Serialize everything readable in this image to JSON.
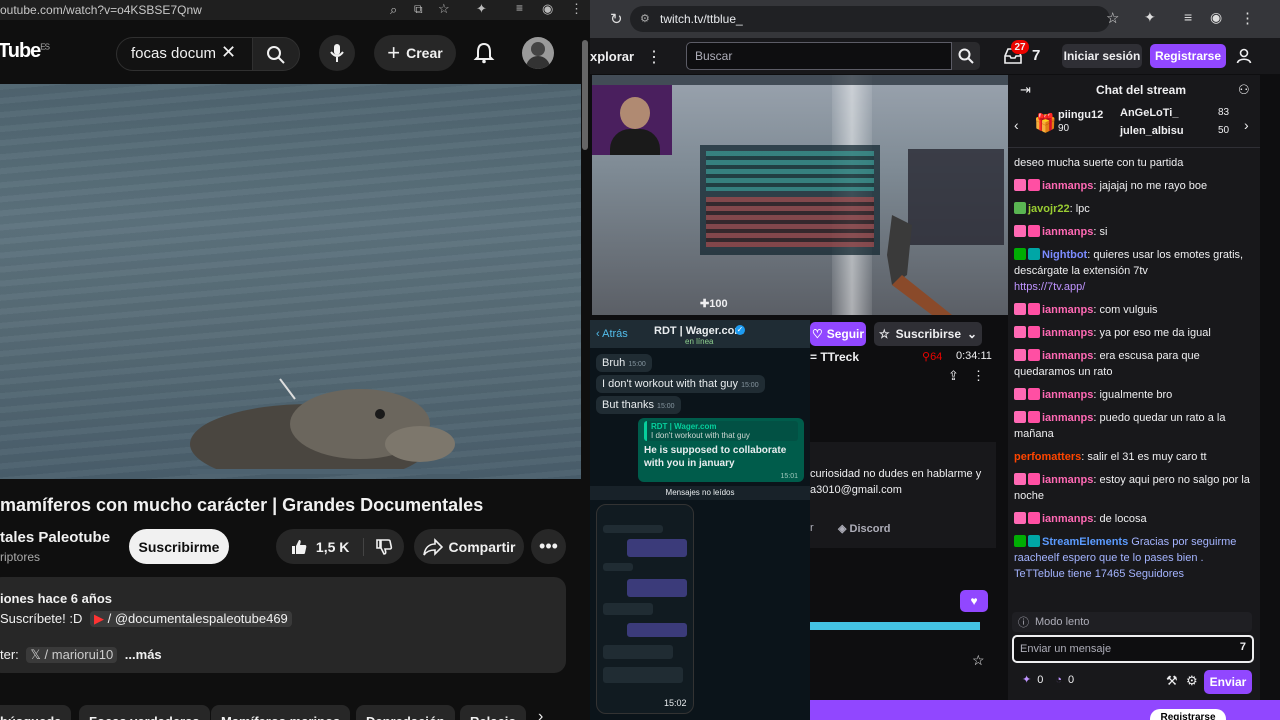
{
  "youtube": {
    "url": "outube.com/watch?v=o4KSBSE7Qnw",
    "logo": "Tube",
    "logo_region": "ES",
    "search_value": "focas docum",
    "create_label": "Crear",
    "video_title": "mamíferos con mucho carácter | Grandes Documentales",
    "channel_name": "tales Paleotube",
    "channel_sub": "riptores",
    "subscribe_label": "Suscribirme",
    "likes": "1,5 K",
    "share_label": "Compartir",
    "desc_meta": "iones  hace 6 años",
    "desc_line2_prefix": "Suscríbete! :D",
    "desc_line2_link": "/ @documentalespaleotube469",
    "desc_line3_prefix": "ter:",
    "desc_line3_link": "/ mariorui10",
    "desc_more": "...más",
    "chips": [
      "búsqueda",
      "Focas verdaderas",
      "Mamíferos marinos",
      "Depredación",
      "Relacio"
    ]
  },
  "twitch": {
    "url": "twitch.tv/ttblue_",
    "explore": "xplorar",
    "search_placeholder": "Buscar",
    "notif_count": "27",
    "login_label": "Iniciar sesión",
    "register_label": "Registrarse",
    "chat_title": "Chat del stream",
    "follow_label": "Seguir",
    "subscribe_label": "Suscribirse",
    "streamer_name": "TTreck",
    "viewers": "64",
    "uptime": "0:34:11",
    "about_text": "curiosidad no dudes en hablarme y",
    "about_email": "a3010@gmail.com",
    "discord_label": "Discord",
    "about_link_prefix": "r",
    "video_hp": "100",
    "leaderboard": [
      {
        "name": "piingu12",
        "count": "90"
      },
      {
        "name": "AnGeLoTi_",
        "count": "83"
      },
      {
        "name": "julen_albisu",
        "count": "50"
      }
    ],
    "slow_mode": "Modo lento",
    "chat_placeholder": "Enviar un mensaje",
    "points_a": "0",
    "points_b": "0",
    "send_label": "Enviar",
    "register_bottom": "Registrarse",
    "messages": [
      {
        "user": "",
        "text": "deseo mucha suerte con tu partida",
        "color": "#efeff1"
      },
      {
        "user": "ianmanps",
        "text": ": jajajaj no me rayo boe",
        "color": "#ff69b4"
      },
      {
        "user": "javojr22",
        "text": ": lpc",
        "color": "#9acd32"
      },
      {
        "user": "ianmanps",
        "text": ": si",
        "color": "#ff69b4"
      },
      {
        "user": "Nightbot",
        "text": ": quieres usar los emotes gratis, descárgate la extensión 7tv",
        "color": "#7c8cff",
        "link": "https://7tv.app/"
      },
      {
        "user": "ianmanps",
        "text": ": com vulguis",
        "color": "#ff69b4"
      },
      {
        "user": "ianmanps",
        "text": ": ya por eso me da igual",
        "color": "#ff69b4"
      },
      {
        "user": "ianmanps",
        "text": ": era escusa para que quedaramos un rato",
        "color": "#ff69b4"
      },
      {
        "user": "ianmanps",
        "text": ": igualmente bro",
        "color": "#ff69b4"
      },
      {
        "user": "ianmanps",
        "text": ": puedo quedar un rato a la mañana",
        "color": "#ff69b4"
      },
      {
        "user": "perfomatters",
        "text": ": salir el 31 es muy caro tt",
        "color": "#ff4500"
      },
      {
        "user": "ianmanps",
        "text": ": estoy aqui pero no salgo por la noche",
        "color": "#ff69b4"
      },
      {
        "user": "ianmanps",
        "text": ": de locosa",
        "color": "#ff69b4"
      },
      {
        "user": "StreamElements",
        "text": " Gracias por seguirme raacheelf",
        "color": "#5b9bff",
        "text2": "espero que te lo pases bien . TeTTeblue tiene 17465 Seguidores"
      }
    ]
  },
  "whatsapp": {
    "back_label": "Atrás",
    "contact": "RDT | Wager.com",
    "status": "en línea",
    "msgs": [
      {
        "text": "Bruh",
        "time": "15:00",
        "dir": "in"
      },
      {
        "text": "I don't workout with that guy",
        "time": "15:00",
        "dir": "in"
      },
      {
        "text": "But thanks",
        "time": "15:00",
        "dir": "in"
      }
    ],
    "reply_quote_name": "RDT | Wager.com",
    "reply_quote_text": "I don't workout with that guy",
    "reply_text": "He is supposed to collaborate with you in january",
    "reply_time": "15:01",
    "unread_label": "Mensajes no leídos",
    "phone_time": "15:02"
  }
}
